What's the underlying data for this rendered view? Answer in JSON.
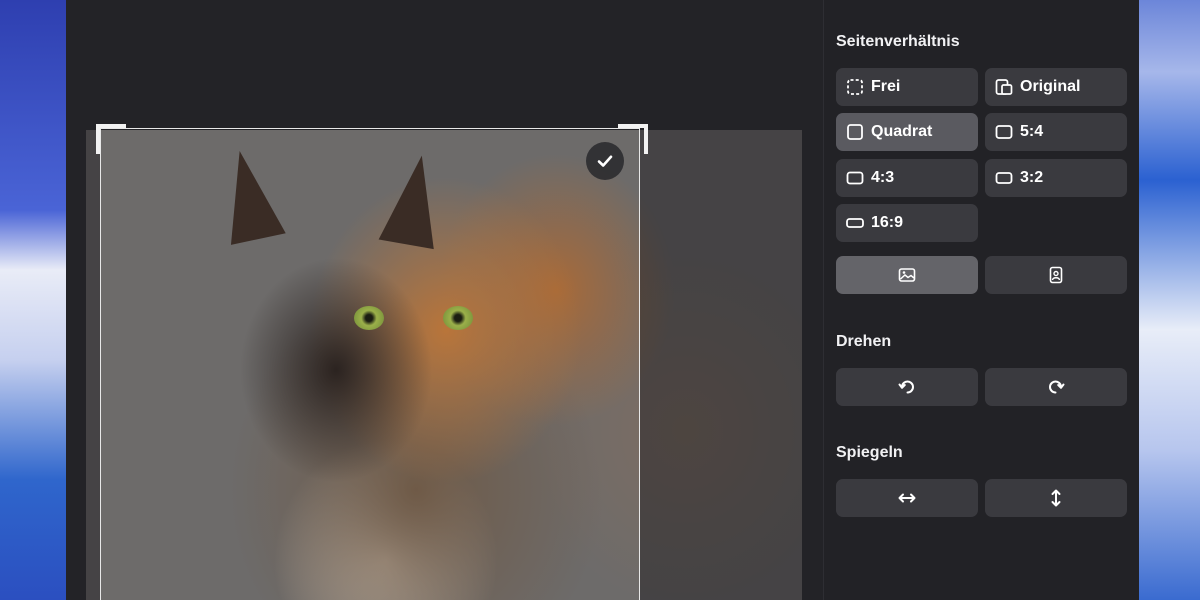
{
  "sections": {
    "aspect_ratio": {
      "title": "Seitenverhältnis",
      "options": [
        {
          "label": "Frei",
          "icon": "dashed-square-icon",
          "active": false
        },
        {
          "label": "Original",
          "icon": "original-image-icon",
          "active": false
        },
        {
          "label": "Quadrat",
          "icon": "square-icon",
          "active": true
        },
        {
          "label": "5:4",
          "icon": "rectangle-icon",
          "active": false
        },
        {
          "label": "4:3",
          "icon": "rectangle-icon",
          "active": false
        },
        {
          "label": "3:2",
          "icon": "rectangle-icon",
          "active": false
        },
        {
          "label": "16:9",
          "icon": "wide-rectangle-icon",
          "active": false
        }
      ],
      "orientation": [
        {
          "icon": "landscape-icon",
          "active": true
        },
        {
          "icon": "portrait-icon",
          "active": false
        }
      ]
    },
    "rotate": {
      "title": "Drehen",
      "buttons": [
        {
          "icon": "rotate-left-icon"
        },
        {
          "icon": "rotate-right-icon"
        }
      ]
    },
    "mirror": {
      "title": "Spiegeln",
      "buttons": [
        {
          "icon": "flip-horizontal-icon"
        },
        {
          "icon": "flip-vertical-icon"
        }
      ]
    }
  },
  "canvas": {
    "confirm_icon": "checkmark-icon"
  },
  "colors": {
    "panel_bg": "#222226",
    "button_bg": "#3a3a3f",
    "button_active_bg": "#5a5a60",
    "text": "#ffffff"
  }
}
